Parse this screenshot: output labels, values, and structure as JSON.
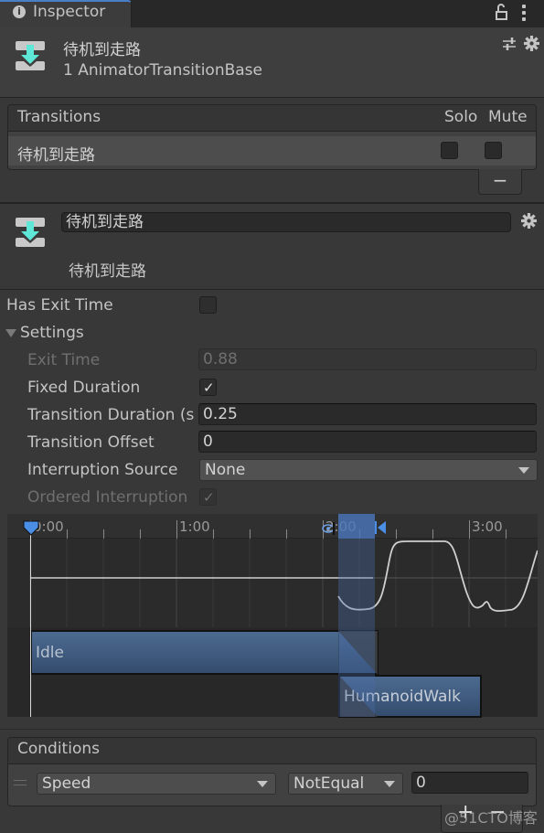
{
  "tab": {
    "icon": "info-icon",
    "label": "Inspector"
  },
  "tab_actions": {
    "lock": "lock-icon",
    "menu": "kebab-menu-icon"
  },
  "header": {
    "icon": "animator-transition-icon",
    "title": "待机到走路",
    "subtitle": "1 AnimatorTransitionBase",
    "actions": [
      "preset-icon",
      "gear-icon"
    ]
  },
  "transitions": {
    "title": "Transitions",
    "solo_label": "Solo",
    "mute_label": "Mute",
    "rows": [
      {
        "name": "待机到走路",
        "solo": false,
        "mute": false
      }
    ],
    "remove_label": "−"
  },
  "transition": {
    "name_value": "待机到走路",
    "subtitle": "待机到走路"
  },
  "settings": {
    "has_exit_time_label": "Has Exit Time",
    "has_exit_time": false,
    "foldout_label": "Settings",
    "exit_time_label": "Exit Time",
    "exit_time_value": "0.88",
    "fixed_duration_label": "Fixed Duration",
    "fixed_duration": true,
    "transition_duration_label": "Transition Duration (s",
    "transition_duration_value": "0.25",
    "transition_offset_label": "Transition Offset",
    "transition_offset_value": "0",
    "interruption_source_label": "Interruption Source",
    "interruption_source_value": "None",
    "ordered_interruption_label": "Ordered Interruption",
    "ordered_interruption": true,
    "checkmark": "✓"
  },
  "timeline": {
    "ticks": [
      "0:00",
      "1:00",
      "2:00",
      "3:00"
    ],
    "clips": [
      {
        "name": "Idle"
      },
      {
        "name": "HumanoidWalk"
      }
    ],
    "transition_start": 2.0,
    "transition_end": 2.25
  },
  "conditions": {
    "title": "Conditions",
    "rows": [
      {
        "parameter": "Speed",
        "mode": "NotEqual",
        "value": "0"
      }
    ],
    "add_label": "+",
    "remove_label": "−"
  },
  "watermark": "@51CTO博客",
  "colors": {
    "accent": "#4a7fc8",
    "clip": "#3f5b80",
    "transition_icon": "#5ee6d6"
  }
}
